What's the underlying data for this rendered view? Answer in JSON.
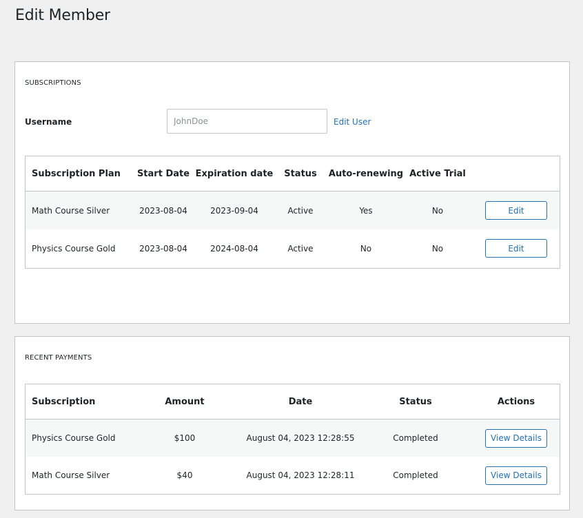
{
  "page": {
    "title": "Edit Member"
  },
  "subscriptions": {
    "section_title": "SUBSCRIPTIONS",
    "username_label": "Username",
    "username_value": "JohnDoe",
    "edit_user_link": "Edit User",
    "columns": [
      "Subscription Plan",
      "Start Date",
      "Expiration date",
      "Status",
      "Auto-renewing",
      "Active Trial"
    ],
    "rows": [
      {
        "plan": "Math Course Silver",
        "start": "2023-08-04",
        "expiration": "2023-09-04",
        "status": "Active",
        "auto_renewing": "Yes",
        "active_trial": "No",
        "action": "Edit"
      },
      {
        "plan": "Physics Course Gold",
        "start": "2023-08-04",
        "expiration": "2024-08-04",
        "status": "Active",
        "auto_renewing": "No",
        "active_trial": "No",
        "action": "Edit"
      }
    ]
  },
  "payments": {
    "section_title": "RECENT PAYMENTS",
    "columns": [
      "Subscription",
      "Amount",
      "Date",
      "Status",
      "Actions"
    ],
    "rows": [
      {
        "subscription": "Physics Course Gold",
        "amount": "$100",
        "date": "August 04, 2023 12:28:55",
        "status": "Completed",
        "action": "View Details"
      },
      {
        "subscription": "Math Course Silver",
        "amount": "$40",
        "date": "August 04, 2023 12:28:11",
        "status": "Completed",
        "action": "View Details"
      }
    ]
  },
  "colors": {
    "background": "#f0f0f1",
    "card_border": "#c3c4c7",
    "link_accent": "#2271b1",
    "alt_row": "#f6f7f7"
  }
}
